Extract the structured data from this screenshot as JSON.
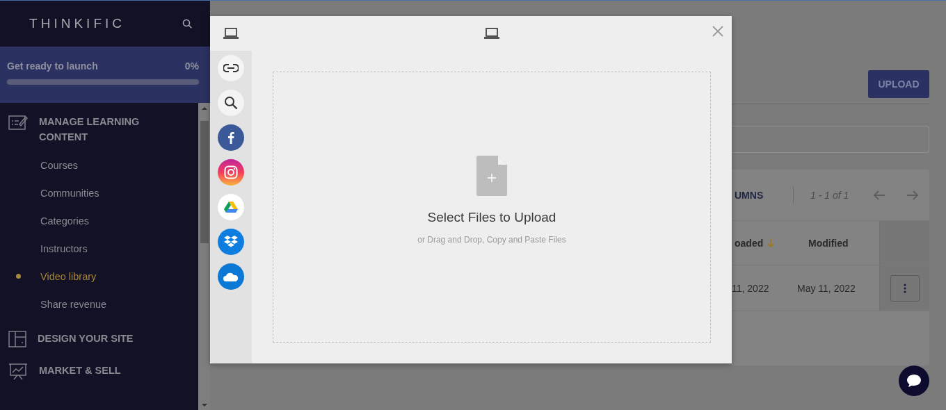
{
  "sidebar": {
    "logo": "THINKIFIC",
    "launch": {
      "label": "Get ready to launch",
      "percent": "0%",
      "level": 0
    },
    "sections": [
      {
        "kind": "edit",
        "title": "MANAGE LEARNING CONTENT",
        "items": [
          {
            "label": "Courses",
            "selected": false
          },
          {
            "label": "Communities",
            "selected": false
          },
          {
            "label": "Categories",
            "selected": false
          },
          {
            "label": "Instructors",
            "selected": false
          },
          {
            "label": "Video library",
            "selected": true
          },
          {
            "label": "Share revenue",
            "selected": false
          }
        ]
      },
      {
        "kind": "layout",
        "title": "DESIGN YOUR SITE"
      },
      {
        "kind": "presentation",
        "title": "MARKET & SELL"
      }
    ]
  },
  "main": {
    "upload_button": "UPLOAD",
    "table": {
      "columns_button": "UMNS",
      "pagination": "1 - 1 of 1",
      "columns": [
        {
          "label": "oaded",
          "sorted": true
        },
        {
          "label": "Modified",
          "sorted": false
        }
      ],
      "rows": [
        [
          "11, 2022",
          "May 11, 2022"
        ]
      ]
    }
  },
  "modal": {
    "sources": [
      {
        "kind": "link"
      },
      {
        "kind": "search"
      },
      {
        "kind": "facebook"
      },
      {
        "kind": "instagram"
      },
      {
        "kind": "drive"
      },
      {
        "kind": "dropbox"
      },
      {
        "kind": "cloud"
      }
    ],
    "dropzone": {
      "title": "Select Files to Upload",
      "hint": "or Drag and Drop, Copy and Paste Files"
    }
  }
}
